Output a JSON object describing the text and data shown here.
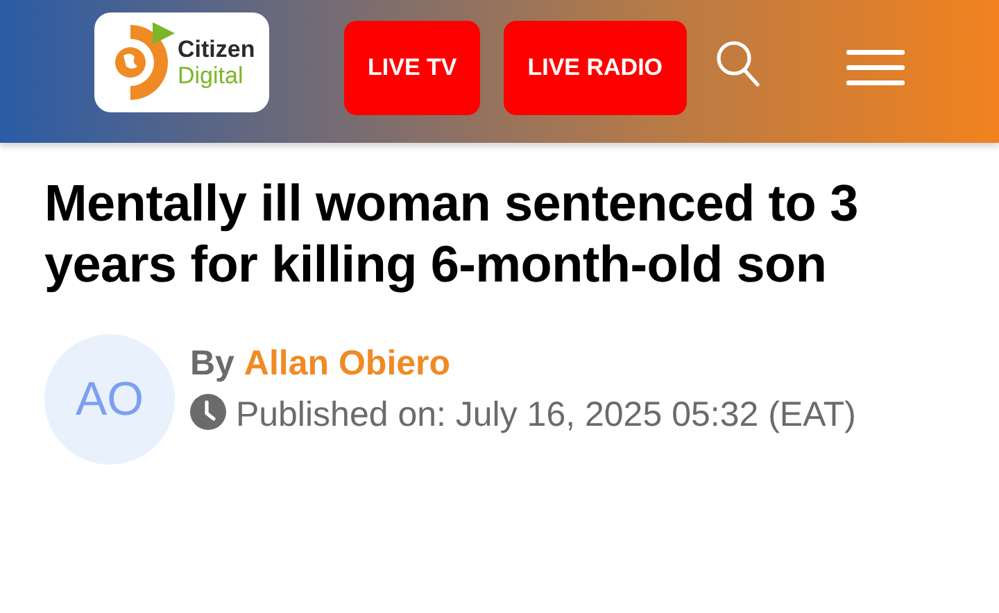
{
  "header": {
    "logo": {
      "line1": "Citizen",
      "line2": "Digital"
    },
    "buttons": [
      {
        "label": "LIVE TV"
      },
      {
        "label": "LIVE RADIO"
      }
    ]
  },
  "article": {
    "title": "Mentally ill woman sentenced to 3 years for killing 6-month-old son",
    "author": {
      "initials": "AO",
      "prefix": "By",
      "name": "Allan Obiero"
    },
    "published": "Published on: July 16, 2025 05:32 (EAT)"
  }
}
